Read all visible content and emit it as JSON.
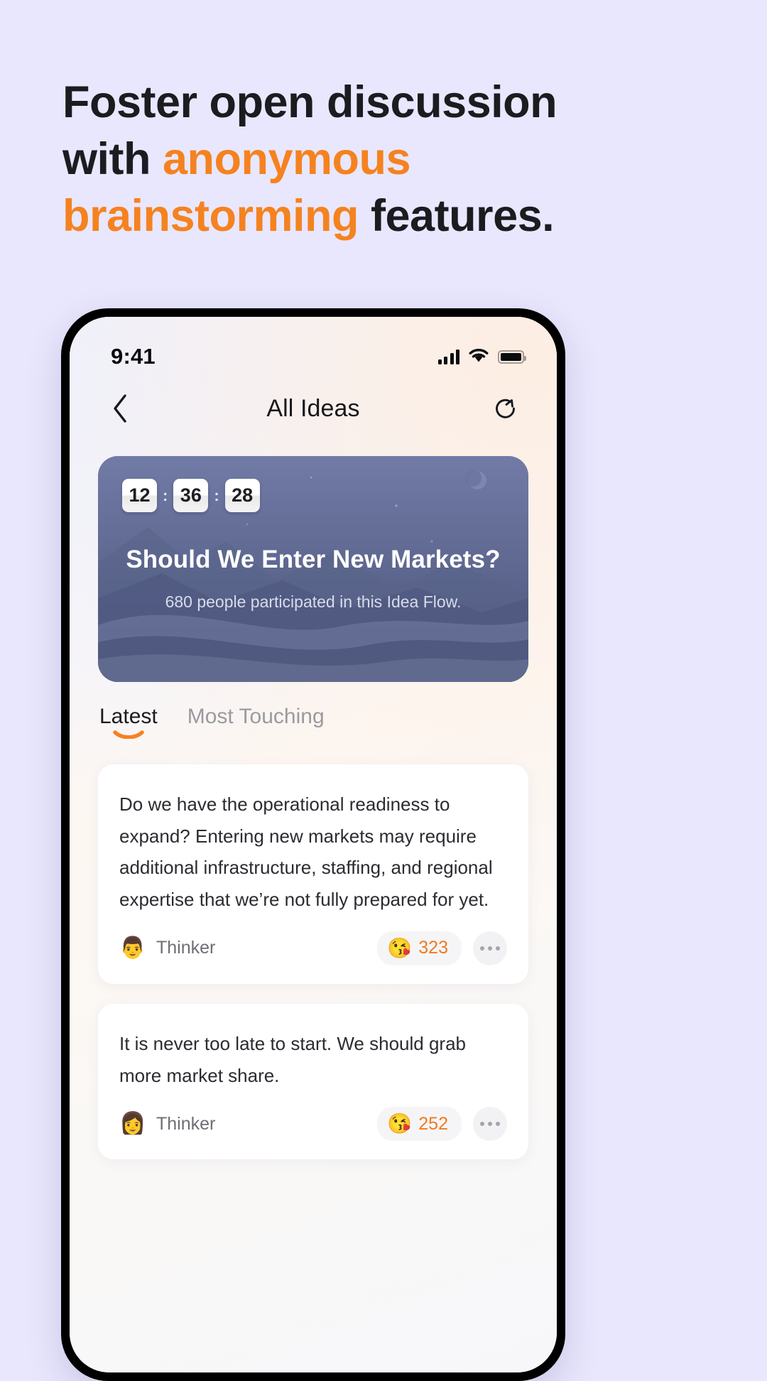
{
  "headline": {
    "line1_plain": "Foster open discussion",
    "line2_plain": "with ",
    "line2_accent": "anonymous",
    "line3_accent": "brainstorming",
    "line3_plain": " features."
  },
  "colors": {
    "accent": "#f58220",
    "page_bg": "#e9e7fd",
    "headline_text": "#1b1c20",
    "hero_bg": "#5d6791",
    "reaction_count": "#f07a1e"
  },
  "status_bar": {
    "time": "9:41",
    "signal_icon": "cellular-signal-icon",
    "wifi_icon": "wifi-icon",
    "battery_icon": "battery-icon"
  },
  "nav": {
    "back_icon": "chevron-left-icon",
    "title": "All Ideas",
    "share_icon": "share-circle-icon"
  },
  "hero": {
    "timer": {
      "hours": "12",
      "minutes": "36",
      "seconds": "28",
      "separator": ":"
    },
    "title": "Should We Enter New Markets?",
    "subtitle": "680 people participated in this Idea Flow."
  },
  "tabs": [
    {
      "label": "Latest",
      "active": true
    },
    {
      "label": "Most Touching",
      "active": false
    }
  ],
  "cards": [
    {
      "text": "Do we have the operational readiness to expand? Entering new markets may require additional infrastructure, staffing, and regional expertise that we’re not fully prepared for yet.",
      "author": "Thinker",
      "avatar_icon": "avatar-person-icon",
      "avatar_glyph": "👨",
      "reaction_emoji": "😘",
      "reaction_count": "323",
      "more_icon": "more-dots-icon"
    },
    {
      "text": "It is never too late to start. We should grab more market share.",
      "author": "Thinker",
      "avatar_icon": "avatar-person-icon",
      "avatar_glyph": "👩",
      "reaction_emoji": "😘",
      "reaction_count": "252",
      "more_icon": "more-dots-icon"
    }
  ]
}
